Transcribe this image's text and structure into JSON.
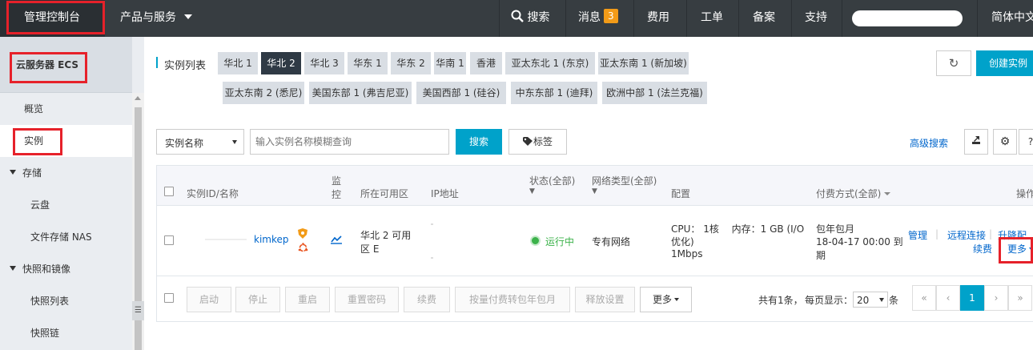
{
  "topbar": {
    "console": "管理控制台",
    "products": "产品与服务",
    "search": "搜索",
    "messages": "消息",
    "message_count": "3",
    "billing": "费用",
    "tickets": "工单",
    "icp": "备案",
    "support": "支持",
    "language": "简体中文"
  },
  "sidebar": {
    "title": "云服务器 ECS",
    "overview": "概览",
    "instances": "实例",
    "storage": "存储",
    "disk": "云盘",
    "nas": "文件存储 NAS",
    "snapshot_group": "快照和镜像",
    "snapshot_list": "快照列表",
    "snapshot_chain": "快照链"
  },
  "main": {
    "section_title": "实例列表",
    "regions_row1": [
      "华北 1",
      "华北 2",
      "华北 3",
      "华东 1",
      "华东 2",
      "华南 1",
      "香港",
      "亚太东北 1 (东京)",
      "亚太东南 1 (新加坡)"
    ],
    "regions_row2": [
      "亚太东南 2 (悉尼)",
      "美国东部 1 (弗吉尼亚)",
      "美国西部 1 (硅谷)",
      "中东东部 1 (迪拜)",
      "欧洲中部 1 (法兰克福)"
    ],
    "active_region": "华北 2",
    "create_button": "创建实例",
    "filter_select": "实例名称",
    "search_placeholder": "输入实例名称模糊查询",
    "search_button": "搜索",
    "tag_button": "标签",
    "advanced_search": "高级搜索",
    "help": "?"
  },
  "table": {
    "headers": {
      "id_name": "实例ID/名称",
      "monitor_1": "监",
      "monitor_2": "控",
      "zone": "所在可用区",
      "ip": "IP地址",
      "status_1": "状态(全部)",
      "status_2": "▼",
      "network_1": "网络类型(全部)",
      "network_2": "▼",
      "config": "配置",
      "billing": "付费方式(全部)",
      "actions": "操作"
    },
    "row": {
      "name": "kimkep",
      "zone_1": "华北 2 可用",
      "zone_2": "区 E",
      "status": "运行中",
      "network": "专有网络",
      "config_1": "CPU： 1核　 内存：1 GB (I/O",
      "config_2": "优化)",
      "config_3": "1Mbps",
      "billing_1": "包年包月",
      "billing_2": "18-04-17 00:00 到",
      "billing_3": "期",
      "action_manage": "管理",
      "action_remote": "远程连接",
      "action_upgrade": "升降配",
      "action_renew": "续费",
      "action_more": "更多"
    }
  },
  "footer": {
    "start": "启动",
    "stop": "停止",
    "restart": "重启",
    "reset_password": "重置密码",
    "renew": "续费",
    "convert": "按量付费转包年包月",
    "release": "释放设置",
    "more": "更多",
    "total": "共有1条，",
    "per_page": "每页显示：",
    "page_size": "20",
    "unit": "条",
    "first": "«",
    "prev": "‹",
    "page": "1",
    "next": "›",
    "last": "»"
  },
  "colors": {
    "topbar": "#373d41",
    "accent": "#00a2ca",
    "highlight": "#e6212a",
    "badge": "#f29b18",
    "running": "#3bb24a"
  }
}
